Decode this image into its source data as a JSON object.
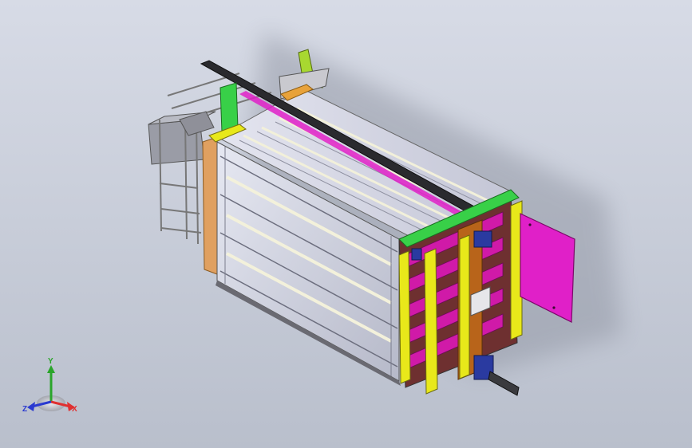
{
  "colors": {
    "background_top": "#d7dbe6",
    "background_bottom": "#b9bfcc",
    "panel_face": "#c9ccd9",
    "panel_stripe": "#ecebd5",
    "frame_gray": "#9ea0a8",
    "frame_dark": "#2a2a2e",
    "accent_magenta": "#e020c8",
    "accent_yellow": "#e8e81a",
    "accent_green": "#38d048",
    "accent_orange": "#e8a23a",
    "accent_brown": "#b8641a",
    "accent_blue": "#2a3aa0",
    "axis_x": "#e03030",
    "axis_y": "#2aa52a",
    "axis_z": "#2a3ad0"
  },
  "triad": {
    "x_label": "X",
    "y_label": "Y",
    "z_label": "Z"
  },
  "model": {
    "description_icon": "cad-assembly-icon"
  }
}
